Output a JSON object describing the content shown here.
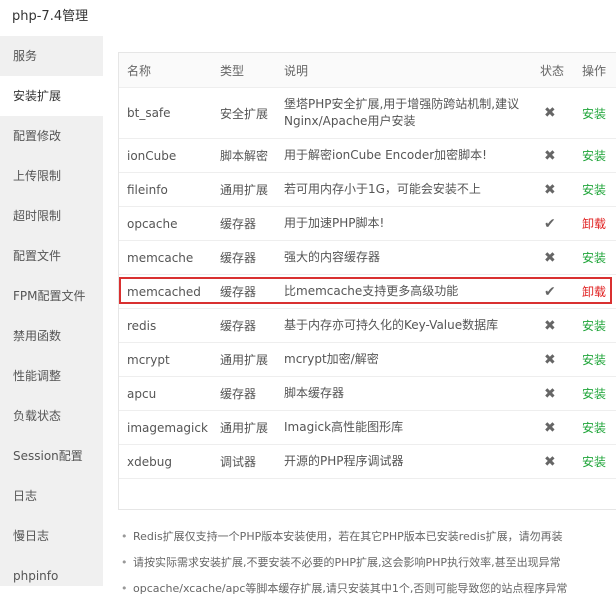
{
  "window": {
    "title": "php-7.4管理"
  },
  "sidebar": {
    "items": [
      {
        "label": "服务"
      },
      {
        "label": "安装扩展",
        "active": true
      },
      {
        "label": "配置修改"
      },
      {
        "label": "上传限制"
      },
      {
        "label": "超时限制"
      },
      {
        "label": "配置文件"
      },
      {
        "label": "FPM配置文件"
      },
      {
        "label": "禁用函数"
      },
      {
        "label": "性能调整"
      },
      {
        "label": "负载状态"
      },
      {
        "label": "Session配置"
      },
      {
        "label": "日志"
      },
      {
        "label": "慢日志"
      },
      {
        "label": "phpinfo"
      }
    ]
  },
  "table": {
    "headers": {
      "name": "名称",
      "type": "类型",
      "desc": "说明",
      "status": "状态",
      "action": "操作"
    },
    "rows": [
      {
        "name": "bt_safe",
        "type": "安全扩展",
        "desc": "堡塔PHP安全扩展,用于增强防跨站机制,建议Nginx/Apache用户安装",
        "status": "✖",
        "action": "安装",
        "installed": false
      },
      {
        "name": "ionCube",
        "type": "脚本解密",
        "desc": "用于解密ionCube Encoder加密脚本!",
        "status": "✖",
        "action": "安装",
        "installed": false
      },
      {
        "name": "fileinfo",
        "type": "通用扩展",
        "desc": "若可用内存小于1G，可能会安装不上",
        "status": "✖",
        "action": "安装",
        "installed": false
      },
      {
        "name": "opcache",
        "type": "缓存器",
        "desc": "用于加速PHP脚本!",
        "status": "✔",
        "action": "卸载",
        "installed": true
      },
      {
        "name": "memcache",
        "type": "缓存器",
        "desc": "强大的内容缓存器",
        "status": "✖",
        "action": "安装",
        "installed": false
      },
      {
        "name": "memcached",
        "type": "缓存器",
        "desc": "比memcache支持更多高级功能",
        "status": "✔",
        "action": "卸载",
        "installed": true,
        "highlighted": true
      },
      {
        "name": "redis",
        "type": "缓存器",
        "desc": "基于内存亦可持久化的Key-Value数据库",
        "status": "✖",
        "action": "安装",
        "installed": false
      },
      {
        "name": "mcrypt",
        "type": "通用扩展",
        "desc": "mcrypt加密/解密",
        "status": "✖",
        "action": "安装",
        "installed": false
      },
      {
        "name": "apcu",
        "type": "缓存器",
        "desc": "脚本缓存器",
        "status": "✖",
        "action": "安装",
        "installed": false
      },
      {
        "name": "imagemagick",
        "type": "通用扩展",
        "desc": "Imagick高性能图形库",
        "status": "✖",
        "action": "安装",
        "installed": false
      },
      {
        "name": "xdebug",
        "type": "调试器",
        "desc": "开源的PHP程序调试器",
        "status": "✖",
        "action": "安装",
        "installed": false
      }
    ]
  },
  "notes": [
    "Redis扩展仅支持一个PHP版本安装使用，若在其它PHP版本已安装redis扩展，请勿再装",
    "请按实际需求安装扩展,不要安装不必要的PHP扩展,这会影响PHP执行效率,甚至出现异常",
    "opcache/xcache/apc等脚本缓存扩展,请只安装其中1个,否则可能导致您的站点程序异常"
  ],
  "colors": {
    "install": "#20a53a",
    "uninstall": "#e02020",
    "highlight_border": "#d93030",
    "sidebar_bg": "#f0f0f0"
  }
}
